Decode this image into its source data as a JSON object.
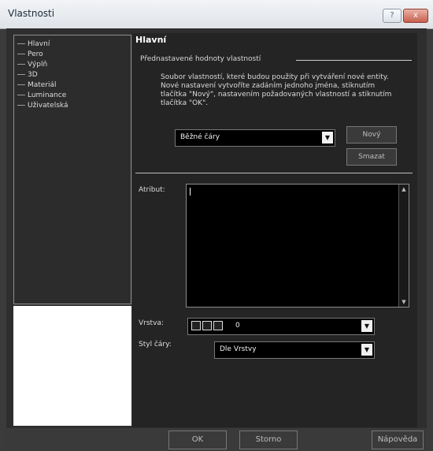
{
  "window": {
    "title": "Vlastnosti",
    "help_label": "?",
    "close_label": "x"
  },
  "sidebar": {
    "items": [
      {
        "label": "Hlavní"
      },
      {
        "label": "Pero"
      },
      {
        "label": "Výplň"
      },
      {
        "label": "3D"
      },
      {
        "label": "Materiál"
      },
      {
        "label": "Luminance"
      },
      {
        "label": "Uživatelská"
      }
    ]
  },
  "main": {
    "section_title": "Hlavní",
    "presets_header": "Přednastavené hodnoty vlastností",
    "description": "Soubor vlastností, které budou použity při vytváření nové entity. Nové nastavení vytvoříte zadáním jednoho jména, stiknutím tlačítka \"Nový\", nastavením požadovaných vlastností a stiknutím tlačítka \"OK\".",
    "preset_select": {
      "value": "Běžné čáry"
    },
    "buttons": {
      "new": "Nový",
      "delete": "Smazat"
    },
    "attribute_label": "Atribut:",
    "attribute_value": "",
    "layer_label": "Vrstva:",
    "layer_select": {
      "value": "0"
    },
    "line_style_label": "Styl čáry:",
    "line_style_select": {
      "value": "Dle Vrstvy"
    }
  },
  "footer": {
    "ok": "OK",
    "cancel": "Storno",
    "help": "Nápověda"
  }
}
